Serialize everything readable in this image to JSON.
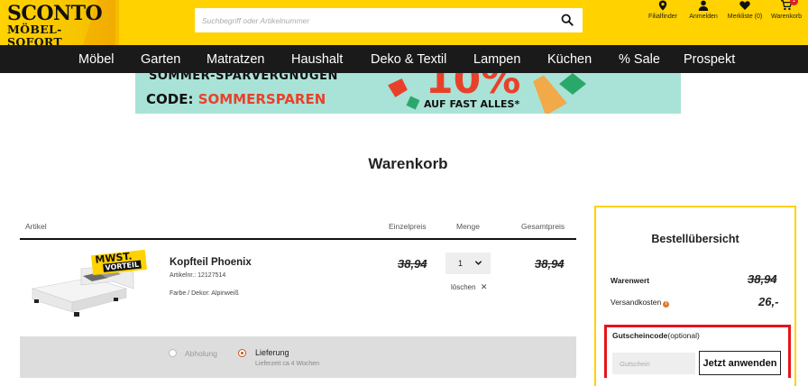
{
  "header": {
    "logo_line1": "SCONTO",
    "logo_line2": "MÖBEL-SOFORT",
    "search_placeholder": "Suchbegriff oder Artikelnummer",
    "icons": [
      {
        "name": "map-pin-icon",
        "label": "Filialfinder"
      },
      {
        "name": "user-icon",
        "label": "Anmelden"
      },
      {
        "name": "heart-icon",
        "label": "Merkliste (0)"
      },
      {
        "name": "cart-icon",
        "label": "Warenkorb",
        "badge": "1"
      }
    ]
  },
  "nav": [
    "Möbel",
    "Garten",
    "Matratzen",
    "Haushalt",
    "Deko & Textil",
    "Lampen",
    "Küchen",
    "% Sale",
    "Prospekt"
  ],
  "banner": {
    "line1": "SOMMER-SPARVERGNÜGEN",
    "code_prefix": "CODE: ",
    "code": "SOMMERSPAREN",
    "percent": "10%",
    "sub": "AUF FAST ALLES*"
  },
  "page_title": "Warenkorb",
  "table": {
    "headers": {
      "article": "Artikel",
      "unit_price": "Einzelpreis",
      "quantity": "Menge",
      "total": "Gesamtpreis"
    }
  },
  "item": {
    "badge_line1": "MWST.",
    "badge_line2": "VORTEIL",
    "name": "Kopfteil Phoenix",
    "article_nr": "Artikelnr.: 12127514",
    "color": "Farbe / Dekor: Alpinweiß",
    "unit_price": "38,94",
    "quantity": "1",
    "total": "38,94",
    "delete_label": "löschen"
  },
  "delivery": {
    "pickup_label": "Abholung",
    "delivery_label": "Lieferung",
    "delivery_time": "Lieferzeit ca 4 Wochen",
    "selected": "delivery"
  },
  "summary": {
    "title": "Bestellübersicht",
    "goods_value_label": "Warenwert",
    "goods_value": "38,94",
    "shipping_label": "Versandkosten",
    "shipping_value": "26,-",
    "coupon_label": "Gutscheincode",
    "coupon_optional": "(optional)",
    "coupon_placeholder": "Gutschein",
    "apply_button": "Jetzt anwenden"
  },
  "colors": {
    "brand_yellow": "#ffd200",
    "nav_black": "#1a1a1a",
    "highlight_red": "#e4141b",
    "promo_red": "#e8412b"
  }
}
